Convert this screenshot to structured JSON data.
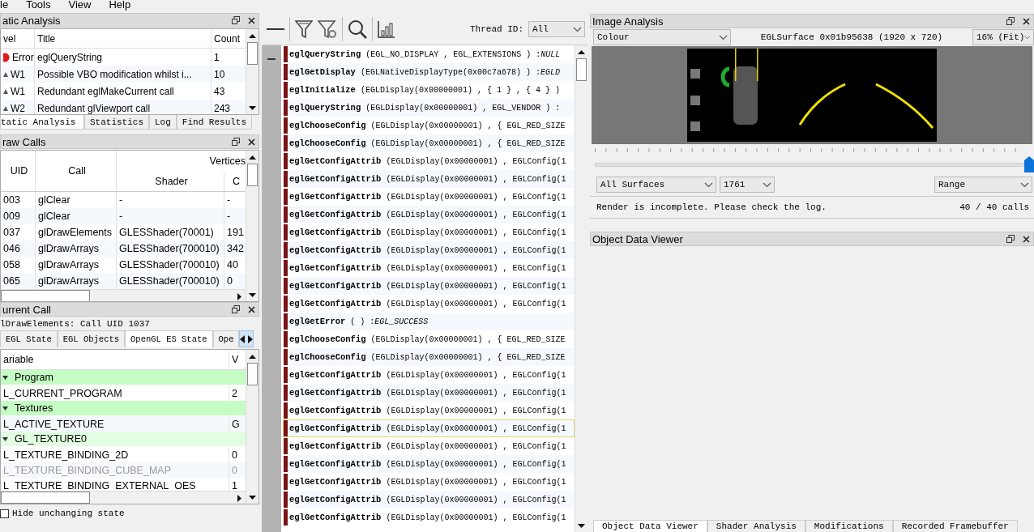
{
  "menu": [
    {
      "label": "le"
    },
    {
      "label": "Tools"
    },
    {
      "label": "View"
    },
    {
      "label": "Help"
    }
  ],
  "static_analysis": {
    "title": "atic Analysis",
    "columns": [
      "vel",
      "Title",
      "Count"
    ],
    "rows": [
      {
        "kind": "error",
        "level": "Error",
        "title": "eglQueryString",
        "count": "1"
      },
      {
        "kind": "warning",
        "level": "W1",
        "title": "Possible VBO modification whilst i...",
        "count": "10"
      },
      {
        "kind": "warning",
        "level": "W1",
        "title": "Redundant eglMakeCurrent call",
        "count": "43"
      },
      {
        "kind": "warning",
        "level": "W2",
        "title": "Redundant glViewport call",
        "count": "243"
      }
    ],
    "tabs": [
      {
        "label": "tatic Analysis",
        "selected": true
      },
      {
        "label": "Statistics",
        "selected": false
      },
      {
        "label": "Log",
        "selected": false
      },
      {
        "label": "Find Results",
        "selected": false
      }
    ]
  },
  "draw_calls": {
    "title": "raw Calls",
    "columns": {
      "uid": "UID",
      "call": "Call",
      "group": "Vertices",
      "shader": "Shader",
      "column_4": "C"
    },
    "rows": [
      {
        "uid": "003",
        "call": "glClear",
        "shader": "-",
        "column_4": "-"
      },
      {
        "uid": "009",
        "call": "glClear",
        "shader": "-",
        "column_4": "-"
      },
      {
        "uid": "037",
        "call": "glDrawElements",
        "shader": "GLESShader(70001)",
        "column_4": "191"
      },
      {
        "uid": "046",
        "call": "glDrawArrays",
        "shader": "GLESShader(700010)",
        "column_4": "342"
      },
      {
        "uid": "058",
        "call": "glDrawArrays",
        "shader": "GLESShader(700010)",
        "column_4": "40"
      },
      {
        "uid": "065",
        "call": "glDrawArrays",
        "shader": "GLESShader(700010)",
        "column_4": "0"
      }
    ]
  },
  "current_call": {
    "title": "urrent Call",
    "call_label": "lDrawElements: Call UID 1037",
    "tabs": [
      {
        "label": "EGL State",
        "selected": false
      },
      {
        "label": "EGL Objects",
        "selected": false
      },
      {
        "label": "OpenGL ES State",
        "selected": true
      },
      {
        "label": "Ope",
        "selected": false
      }
    ],
    "columns": [
      "ariable",
      "V"
    ],
    "tree": [
      {
        "label": "Program",
        "expanded": true,
        "children": [
          {
            "label": "L_CURRENT_PROGRAM",
            "value": "2",
            "greyed": false
          }
        ]
      },
      {
        "label": "Textures",
        "expanded": true,
        "children": [
          {
            "label": "L_ACTIVE_TEXTURE",
            "value": "G",
            "greyed": false
          },
          {
            "label": "GL_TEXTURE0",
            "expanded": true,
            "children": [
              {
                "label": "L_TEXTURE_BINDING_2D",
                "value": "0",
                "greyed": false
              },
              {
                "label": "L_TEXTURE_BINDING_CUBE_MAP",
                "value": "0",
                "greyed": true
              },
              {
                "label": "L_TEXTURE_BINDING_EXTERNAL_OES",
                "value": "1",
                "greyed": false
              }
            ]
          }
        ]
      }
    ],
    "hide_unchanging": {
      "label": "Hide unchanging state",
      "checked": false
    }
  },
  "trace": {
    "thread_label": "Thread ID:",
    "thread_value": "All",
    "calls": [
      {
        "name": "eglQueryString",
        "args": "(EGL_NO_DISPLAY , EGL_EXTENSIONS ) : ",
        "result": "NULL",
        "selected": false
      },
      {
        "name": "eglGetDisplay",
        "args": "(EGLNativeDisplayType(0x00c7a678) ) : ",
        "result": "EGLD",
        "selected": false
      },
      {
        "name": "eglInitialize",
        "args": "(EGLDisplay(0x00000001) , { 1 } , { 4 } )",
        "selected": false
      },
      {
        "name": "eglQueryString",
        "args": "(EGLDisplay(0x00000001) , EGL_VENDOR ) :",
        "selected": false
      },
      {
        "name": "eglChooseConfig",
        "args": "(EGLDisplay(0x00000001) , { EGL_RED_SIZE",
        "selected": false
      },
      {
        "name": "eglChooseConfig",
        "args": "(EGLDisplay(0x00000001) , { EGL_RED_SIZE",
        "selected": false
      },
      {
        "name": "eglGetConfigAttrib",
        "args": "(EGLDisplay(0x00000001) , EGLConfig(1",
        "selected": false
      },
      {
        "name": "eglGetConfigAttrib",
        "args": "(EGLDisplay(0x00000001) , EGLConfig(1",
        "selected": false
      },
      {
        "name": "eglGetConfigAttrib",
        "args": "(EGLDisplay(0x00000001) , EGLConfig(1",
        "selected": false
      },
      {
        "name": "eglGetConfigAttrib",
        "args": "(EGLDisplay(0x00000001) , EGLConfig(1",
        "selected": false
      },
      {
        "name": "eglGetConfigAttrib",
        "args": "(EGLDisplay(0x00000001) , EGLConfig(1",
        "selected": false
      },
      {
        "name": "eglGetConfigAttrib",
        "args": "(EGLDisplay(0x00000001) , EGLConfig(1",
        "selected": false
      },
      {
        "name": "eglGetConfigAttrib",
        "args": "(EGLDisplay(0x00000001) , EGLConfig(1",
        "selected": false
      },
      {
        "name": "eglGetConfigAttrib",
        "args": "(EGLDisplay(0x00000001) , EGLConfig(1",
        "selected": false
      },
      {
        "name": "eglGetConfigAttrib",
        "args": "(EGLDisplay(0x00000001) , EGLConfig(1",
        "selected": false
      },
      {
        "name": "eglGetError",
        "args": "( ) : ",
        "result": "EGL_SUCCESS",
        "selected": false
      },
      {
        "name": "eglChooseConfig",
        "args": "(EGLDisplay(0x00000001) , { EGL_RED_SIZE",
        "selected": false
      },
      {
        "name": "eglChooseConfig",
        "args": "(EGLDisplay(0x00000001) , { EGL_RED_SIZE",
        "selected": false
      },
      {
        "name": "eglGetConfigAttrib",
        "args": "(EGLDisplay(0x00000001) , EGLConfig(1",
        "selected": false
      },
      {
        "name": "eglGetConfigAttrib",
        "args": "(EGLDisplay(0x00000001) , EGLConfig(1",
        "selected": false
      },
      {
        "name": "eglGetConfigAttrib",
        "args": "(EGLDisplay(0x00000001) , EGLConfig(1",
        "selected": false
      },
      {
        "name": "eglGetConfigAttrib",
        "args": "(EGLDisplay(0x00000001) , EGLConfig(1",
        "selected": true
      },
      {
        "name": "eglGetConfigAttrib",
        "args": "(EGLDisplay(0x00000001) , EGLConfig(1",
        "selected": false
      },
      {
        "name": "eglGetConfigAttrib",
        "args": "(EGLDisplay(0x00000001) , EGLConfig(1",
        "selected": false
      },
      {
        "name": "eglGetConfigAttrib",
        "args": "(EGLDisplay(0x00000001) , EGLConfig(1",
        "selected": false
      },
      {
        "name": "eglGetConfigAttrib",
        "args": "(EGLDisplay(0x00000001) , EGLConfig(1",
        "selected": false
      },
      {
        "name": "eglGetConfigAttrib",
        "args": "(EGLDisplay(0x00000001) , EGLConfig(1",
        "selected": false
      }
    ]
  },
  "image_analysis": {
    "title": "Image Analysis",
    "channel": "Colour",
    "surface": "EGLSurface 0x01b95638 (1920 x 720)",
    "zoom": "16% (Fit)",
    "frame_slider": {
      "level": 1
    },
    "surface_filter": "All Surfaces",
    "frame": "1761",
    "mode": "Range",
    "status": "Render is incomplete. Please check the log.",
    "calls_count": "40 / 40 calls"
  },
  "object_data_viewer": {
    "title": "Object Data Viewer",
    "tabs": [
      {
        "label": "Object Data Viewer",
        "selected": true
      },
      {
        "label": "Shader Analysis",
        "selected": false
      },
      {
        "label": "Modifications",
        "selected": false
      },
      {
        "label": "Recorded Framebuffer",
        "selected": false
      }
    ]
  }
}
